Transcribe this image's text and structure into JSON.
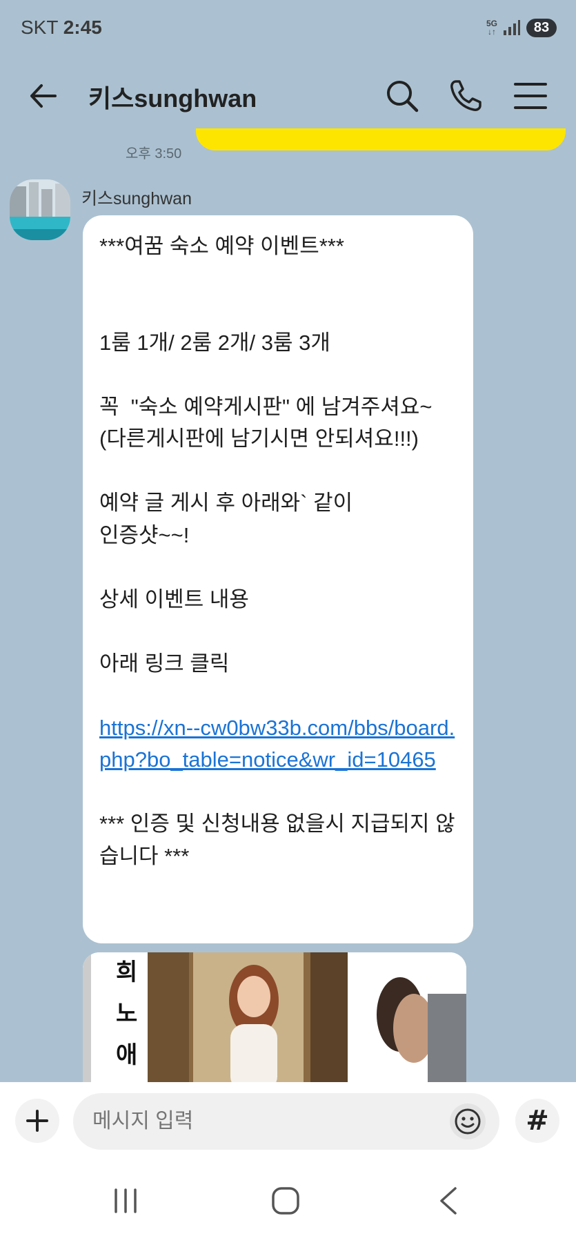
{
  "status_bar": {
    "carrier": "SKT",
    "time": "2:45",
    "network": "5G",
    "battery": "83"
  },
  "header": {
    "title": "키스sunghwan"
  },
  "chat": {
    "my_message_time": "오후 3:50",
    "sender_name": "키스sunghwan",
    "message": {
      "line1": "***여꿈 숙소 예약 이벤트***",
      "line2": "1룸 1개/ 2룸 2개/ 3룸 3개",
      "line3": "꼭  \"숙소 예약게시판\" 에 남겨주셔요~",
      "line4": "(다른게시판에 남기시면 안되셔요!!!)",
      "line5": "예약 글 게시 후 아래와` 같이",
      "line6": "인증샷~~!",
      "line7": "상세 이벤트 내용",
      "line8": "아래 링크 클릭",
      "link": "https://xn--cw0bw33b.com/bbs/board.php?bo_table=notice&wr_id=10465",
      "line9": "*** 인증 및 신청내용 없을시 지급되지 않습니다 ***"
    },
    "image_text": [
      "희",
      "노",
      "애"
    ]
  },
  "input": {
    "placeholder": "메시지 입력",
    "hash_label": "#"
  }
}
